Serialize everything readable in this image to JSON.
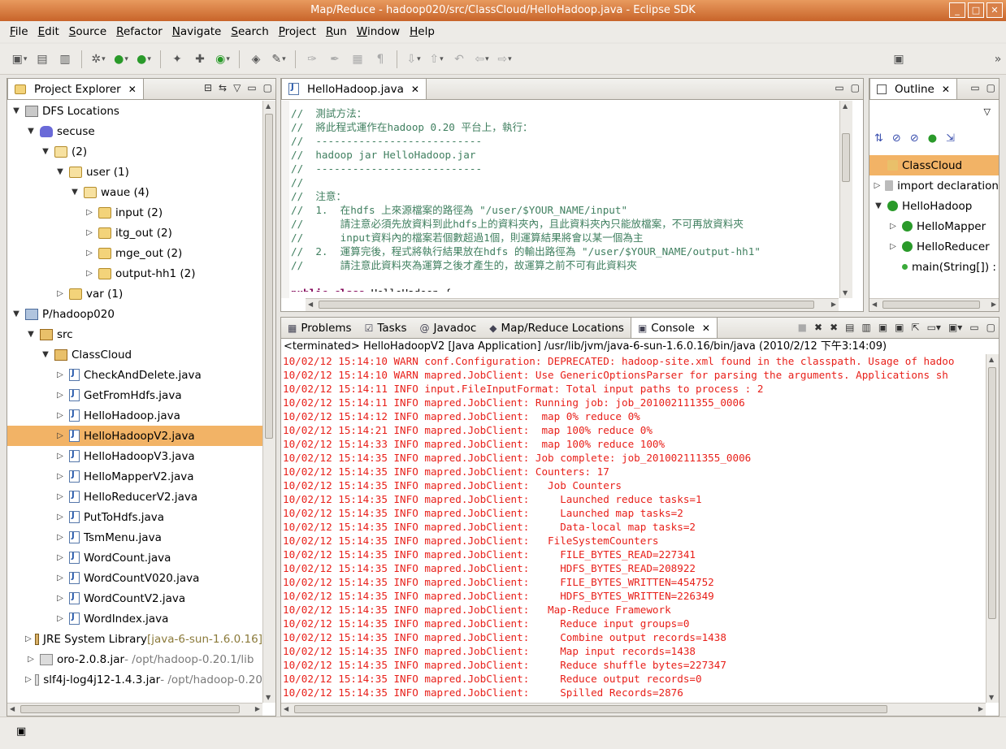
{
  "window": {
    "title": "Map/Reduce - hadoop020/src/ClassCloud/HelloHadoop.java - Eclipse SDK"
  },
  "menu": [
    "File",
    "Edit",
    "Source",
    "Refactor",
    "Navigate",
    "Search",
    "Project",
    "Run",
    "Window",
    "Help"
  ],
  "explorer": {
    "tab_label": "Project Explorer",
    "rows": [
      {
        "label": "DFS Locations",
        "depth": 0,
        "twisty": "▼",
        "icon": "db"
      },
      {
        "label": "secuse",
        "depth": 1,
        "twisty": "▼",
        "icon": "ele"
      },
      {
        "label": "(2)",
        "depth": 2,
        "twisty": "▼",
        "icon": "open"
      },
      {
        "label": "user (1)",
        "depth": 3,
        "twisty": "▼",
        "icon": "open"
      },
      {
        "label": "waue (4)",
        "depth": 4,
        "twisty": "▼",
        "icon": "open"
      },
      {
        "label": "input (2)",
        "depth": 5,
        "twisty": "▷",
        "icon": "folder"
      },
      {
        "label": "itg_out (2)",
        "depth": 5,
        "twisty": "▷",
        "icon": "folder"
      },
      {
        "label": "mge_out (2)",
        "depth": 5,
        "twisty": "▷",
        "icon": "folder"
      },
      {
        "label": "output-hh1 (2)",
        "depth": 5,
        "twisty": "▷",
        "icon": "folder"
      },
      {
        "label": "var (1)",
        "depth": 3,
        "twisty": "▷",
        "icon": "folder"
      },
      {
        "label": "P/hadoop020",
        "depth": 0,
        "twisty": "▼",
        "icon": "proj"
      },
      {
        "label": "src",
        "depth": 1,
        "twisty": "▼",
        "icon": "pkg"
      },
      {
        "label": "ClassCloud",
        "depth": 2,
        "twisty": "▼",
        "icon": "pkg"
      },
      {
        "label": "CheckAndDelete.java",
        "depth": 3,
        "twisty": "▷",
        "icon": "java"
      },
      {
        "label": "GetFromHdfs.java",
        "depth": 3,
        "twisty": "▷",
        "icon": "java"
      },
      {
        "label": "HelloHadoop.java",
        "depth": 3,
        "twisty": "▷",
        "icon": "java"
      },
      {
        "label": "HelloHadoopV2.java",
        "depth": 3,
        "twisty": "▷",
        "icon": "java",
        "selected": true
      },
      {
        "label": "HelloHadoopV3.java",
        "depth": 3,
        "twisty": "▷",
        "icon": "java"
      },
      {
        "label": "HelloMapperV2.java",
        "depth": 3,
        "twisty": "▷",
        "icon": "java"
      },
      {
        "label": "HelloReducerV2.java",
        "depth": 3,
        "twisty": "▷",
        "icon": "java"
      },
      {
        "label": "PutToHdfs.java",
        "depth": 3,
        "twisty": "▷",
        "icon": "java"
      },
      {
        "label": "TsmMenu.java",
        "depth": 3,
        "twisty": "▷",
        "icon": "java"
      },
      {
        "label": "WordCount.java",
        "depth": 3,
        "twisty": "▷",
        "icon": "java"
      },
      {
        "label": "WordCountV020.java",
        "depth": 3,
        "twisty": "▷",
        "icon": "java"
      },
      {
        "label": "WordCountV2.java",
        "depth": 3,
        "twisty": "▷",
        "icon": "java"
      },
      {
        "label": "WordIndex.java",
        "depth": 3,
        "twisty": "▷",
        "icon": "java"
      },
      {
        "label": "JRE System Library",
        "suffix": " [java-6-sun-1.6.0.16]",
        "suffix_style": "olive",
        "depth": 1,
        "twisty": "▷",
        "icon": "lib"
      },
      {
        "label": "oro-2.0.8.jar",
        "suffix": " - /opt/hadoop-0.20.1/lib",
        "suffix_style": "gray",
        "depth": 1,
        "twisty": "▷",
        "icon": "jar"
      },
      {
        "label": "slf4j-log4j12-1.4.3.jar",
        "suffix": " - /opt/hadoop-0.20",
        "suffix_style": "gray",
        "depth": 1,
        "twisty": "▷",
        "icon": "jar"
      }
    ]
  },
  "editor": {
    "tab_label": "HelloHadoop.java",
    "lines": [
      {
        "text": "//  測試方法：",
        "cls": ""
      },
      {
        "text": "//  將此程式運作在hadoop 0.20 平台上，執行：",
        "cls": ""
      },
      {
        "text": "//  ---------------------------",
        "cls": ""
      },
      {
        "text": "//  hadoop jar HelloHadoop.jar",
        "cls": ""
      },
      {
        "text": "//  ---------------------------",
        "cls": ""
      },
      {
        "text": "//",
        "cls": ""
      },
      {
        "text": "//  注意：",
        "cls": ""
      },
      {
        "text": "//  1.  在hdfs 上來源檔案的路徑為 \"/user/$YOUR_NAME/input\"",
        "cls": ""
      },
      {
        "text": "//      請注意必須先放資料到此hdfs上的資料夾內，且此資料夾內只能放檔案，不可再放資料夾",
        "cls": ""
      },
      {
        "text": "//      input資料內的檔案若個數超過1個，則運算結果將會以某一個為主",
        "cls": ""
      },
      {
        "text": "//  2.  運算完後，程式將執行結果放在hdfs 的輸出路徑為 \"/user/$YOUR_NAME/output-hh1\"",
        "cls": ""
      },
      {
        "text": "//      請注意此資料夾為運算之後才產生的，故運算之前不可有此資料夾",
        "cls": ""
      },
      {
        "text": "",
        "cls": ""
      },
      {
        "text": "public class HelloHadoop {",
        "cls": "kw"
      }
    ]
  },
  "outline": {
    "tab_label": "Outline",
    "rows": [
      {
        "label": "ClassCloud",
        "depth": 0,
        "twisty": "",
        "selected": true
      },
      {
        "label": "import declaration",
        "depth": 0,
        "twisty": "▷"
      },
      {
        "label": "HelloHadoop",
        "depth": 0,
        "twisty": "▼"
      },
      {
        "label": "HelloMapper",
        "depth": 1,
        "twisty": "▷"
      },
      {
        "label": "HelloReducer",
        "depth": 1,
        "twisty": "▷"
      },
      {
        "label": "main(String[]) :",
        "depth": 1,
        "twisty": ""
      }
    ]
  },
  "bottom_tabs": [
    "Problems",
    "Tasks",
    "Javadoc",
    "Map/Reduce Locations",
    "Console"
  ],
  "console": {
    "header": "<terminated> HelloHadoopV2 [Java Application] /usr/lib/jvm/java-6-sun-1.6.0.16/bin/java (2010/2/12 下午3:14:09)",
    "lines": [
      "10/02/12 15:14:10 WARN conf.Configuration: DEPRECATED: hadoop-site.xml found in the classpath. Usage of hadoo",
      "10/02/12 15:14:10 WARN mapred.JobClient: Use GenericOptionsParser for parsing the arguments. Applications sh",
      "10/02/12 15:14:11 INFO input.FileInputFormat: Total input paths to process : 2",
      "10/02/12 15:14:11 INFO mapred.JobClient: Running job: job_201002111355_0006",
      "10/02/12 15:14:12 INFO mapred.JobClient:  map 0% reduce 0%",
      "10/02/12 15:14:21 INFO mapred.JobClient:  map 100% reduce 0%",
      "10/02/12 15:14:33 INFO mapred.JobClient:  map 100% reduce 100%",
      "10/02/12 15:14:35 INFO mapred.JobClient: Job complete: job_201002111355_0006",
      "10/02/12 15:14:35 INFO mapred.JobClient: Counters: 17",
      "10/02/12 15:14:35 INFO mapred.JobClient:   Job Counters",
      "10/02/12 15:14:35 INFO mapred.JobClient:     Launched reduce tasks=1",
      "10/02/12 15:14:35 INFO mapred.JobClient:     Launched map tasks=2",
      "10/02/12 15:14:35 INFO mapred.JobClient:     Data-local map tasks=2",
      "10/02/12 15:14:35 INFO mapred.JobClient:   FileSystemCounters",
      "10/02/12 15:14:35 INFO mapred.JobClient:     FILE_BYTES_READ=227341",
      "10/02/12 15:14:35 INFO mapred.JobClient:     HDFS_BYTES_READ=208922",
      "10/02/12 15:14:35 INFO mapred.JobClient:     FILE_BYTES_WRITTEN=454752",
      "10/02/12 15:14:35 INFO mapred.JobClient:     HDFS_BYTES_WRITTEN=226349",
      "10/02/12 15:14:35 INFO mapred.JobClient:   Map-Reduce Framework",
      "10/02/12 15:14:35 INFO mapred.JobClient:     Reduce input groups=0",
      "10/02/12 15:14:35 INFO mapred.JobClient:     Combine output records=1438",
      "10/02/12 15:14:35 INFO mapred.JobClient:     Map input records=1438",
      "10/02/12 15:14:35 INFO mapred.JobClient:     Reduce shuffle bytes=227347",
      "10/02/12 15:14:35 INFO mapred.JobClient:     Reduce output records=0",
      "10/02/12 15:14:35 INFO mapred.JobClient:     Spilled Records=2876"
    ]
  },
  "colors": {
    "selection": "#f2b366",
    "console_text": "#e8201a",
    "comment": "#3f7f5f",
    "keyword": "#7f0055",
    "title_bar": "#d8783c"
  }
}
